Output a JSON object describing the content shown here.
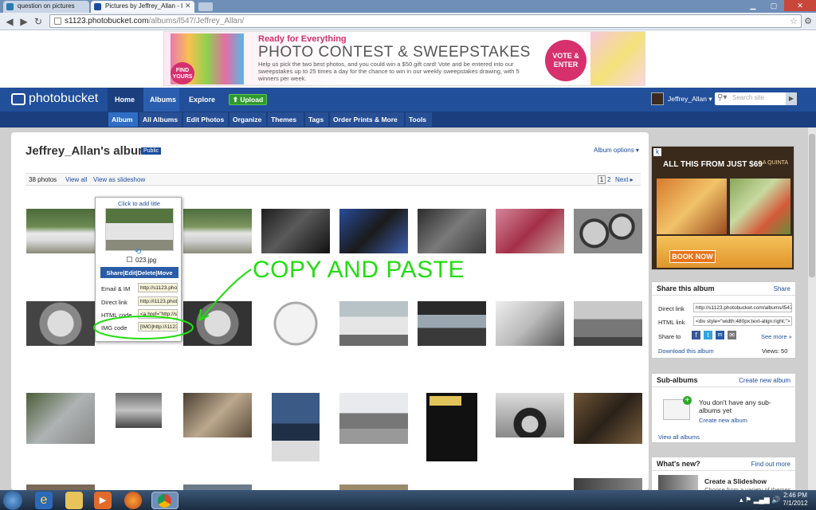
{
  "browser": {
    "tabs": [
      {
        "title": "question on pictures"
      },
      {
        "title": "Pictures by Jeffrey_Allan - I"
      }
    ],
    "url_host": "s1123.photobucket.com",
    "url_path": "/albums/l547/Jeffrey_Allan/"
  },
  "ad": {
    "headline": "Ready for Everything",
    "title": "PHOTO CONTEST & SWEEPSTAKES",
    "body": "Help us pick the two best photos, and you could win a $50 gift card! Vote and be entered into our sweepstakes up to 25 times a day for the chance to win in our weekly sweepstakes drawing, with 5 winners per week.",
    "find": "FIND YOURS",
    "vote": "VOTE & ENTER"
  },
  "header": {
    "logo": "photobucket",
    "nav": [
      "Home",
      "Albums",
      "Explore"
    ],
    "upload": "Upload",
    "user": "Jeffrey_Allan",
    "search_placeholder": "Search site"
  },
  "subnav": [
    "Album",
    "All Albums",
    "Edit Photos",
    "Organize",
    "Themes",
    "Tags",
    "Order Prints & More",
    "Tools"
  ],
  "album": {
    "title": "Jeffrey_Allan's album",
    "badge": "Public",
    "options": "Album options",
    "count": "38 photos",
    "view_all": "View all",
    "slideshow": "View as slideshow",
    "pages": [
      "1",
      "2"
    ],
    "next": "Next"
  },
  "popup": {
    "add_title": "Click to add title",
    "filename": "023.jpg",
    "actions": [
      "Share",
      "Edit",
      "Delete",
      "Move"
    ],
    "rows": [
      {
        "label": "Email & IM",
        "value": "http://s1123.photo"
      },
      {
        "label": "Direct link",
        "value": "http://i1123.photo"
      },
      {
        "label": "HTML code",
        "value": "<a href=\"http://s1"
      },
      {
        "label": "IMG code",
        "value": "[IMG]http://i1123."
      }
    ]
  },
  "annotation": "COPY AND PASTE",
  "sidead": {
    "text": "ALL THIS FROM JUST $69",
    "brand": "LA QUINTA",
    "cta": "BOOK NOW"
  },
  "share": {
    "title": "Share this album",
    "share": "Share",
    "direct_label": "Direct link",
    "direct_value": "http://s1123.photobucket.com/albums/l547",
    "html_label": "HTML link",
    "html_value": "<div style=\"width:480px;text-align:right;\">",
    "share_to": "Share to",
    "see_more": "See more",
    "download": "Download this album",
    "views": "Views: 50"
  },
  "subalbums": {
    "title": "Sub-albums",
    "create": "Create new album",
    "msg": "You don't have any sub-albums yet",
    "create2": "Create new album",
    "view_all": "View all albums"
  },
  "whatsnew": {
    "title": "What's new?",
    "more": "Find out more",
    "item": "Create a Slideshow",
    "sub": "Choose from a variety of themes"
  },
  "taskbar": {
    "time": "2:46 PM",
    "date": "7/1/2012"
  },
  "colors": {
    "header": "#214f9a",
    "subnav": "#1b3f7e",
    "link": "#1b4c9e",
    "annotation": "#22dd11",
    "popup_button": "#2a5ca8"
  }
}
